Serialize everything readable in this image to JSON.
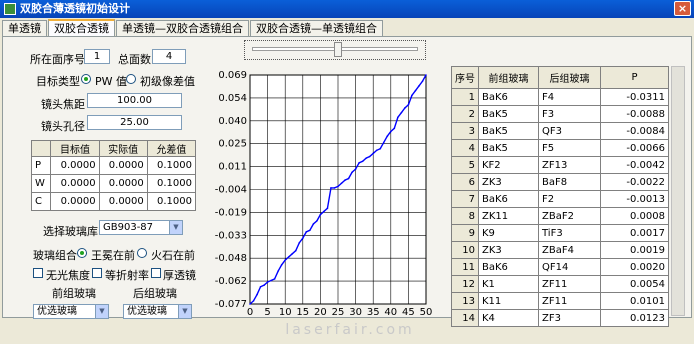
{
  "window": {
    "title": "双胶合薄透镜初始设计",
    "close": "×"
  },
  "tabs": [
    "单透镜",
    "双胶合透镜",
    "单透镜—双胶合透镜组合",
    "双胶合透镜—单透镜组合"
  ],
  "form": {
    "surface_index_label": "所在面序号",
    "surface_index": "1",
    "total_surfaces_label": "总面数",
    "total_surfaces": "4",
    "target_type_label": "目标类型",
    "target_opt1": "PW 值",
    "target_opt2": "初级像差值",
    "focal_label": "镜头焦距",
    "focal_value": "100.00",
    "aperture_label": "镜头孔径",
    "aperture_value": "25.00",
    "glass_lib_label": "选择玻璃库",
    "glass_lib_value": "GB903-87",
    "combo_label": "玻璃组合",
    "combo_opt1": "王冕在前",
    "combo_opt2": "火石在前",
    "check1": "无光焦度",
    "check2": "等折射率",
    "check3": "厚透镜",
    "front_glass_label": "前组玻璃",
    "rear_glass_label": "后组玻璃",
    "front_glass_value": "优选玻璃",
    "rear_glass_value": "优选玻璃"
  },
  "aberration_table": {
    "headers": [
      "",
      "目标值",
      "实际值",
      "允差值"
    ],
    "rows": [
      [
        "P",
        "0.0000",
        "0.0000",
        "0.1000"
      ],
      [
        "W",
        "0.0000",
        "0.0000",
        "0.1000"
      ],
      [
        "C",
        "0.0000",
        "0.0000",
        "0.1000"
      ]
    ]
  },
  "glass_table": {
    "headers": [
      "序号",
      "前组玻璃",
      "后组玻璃",
      "P"
    ],
    "rows": [
      [
        "1",
        "BaK6",
        "F4",
        "-0.0311"
      ],
      [
        "2",
        "BaK5",
        "F3",
        "-0.0088"
      ],
      [
        "3",
        "BaK5",
        "QF3",
        "-0.0084"
      ],
      [
        "4",
        "BaK5",
        "F5",
        "-0.0066"
      ],
      [
        "5",
        "KF2",
        "ZF13",
        "-0.0042"
      ],
      [
        "6",
        "ZK3",
        "BaF8",
        "-0.0022"
      ],
      [
        "7",
        "BaK6",
        "F2",
        "-0.0013"
      ],
      [
        "8",
        "ZK11",
        "ZBaF2",
        "0.0008"
      ],
      [
        "9",
        "K9",
        "TiF3",
        "0.0017"
      ],
      [
        "10",
        "ZK3",
        "ZBaF4",
        "0.0019"
      ],
      [
        "11",
        "BaK6",
        "QF14",
        "0.0020"
      ],
      [
        "12",
        "K1",
        "ZF11",
        "0.0054"
      ],
      [
        "13",
        "K11",
        "ZF11",
        "0.0101"
      ],
      [
        "14",
        "K4",
        "ZF3",
        "0.0123"
      ]
    ]
  },
  "slider": {
    "value_fraction": 0.52
  },
  "chart_data": {
    "type": "line",
    "xlim": [
      0,
      50
    ],
    "ylim": [
      -0.077,
      0.069
    ],
    "xticks": [
      "0",
      "5",
      "10",
      "15",
      "20",
      "25",
      "30",
      "35",
      "40",
      "45",
      "50"
    ],
    "yticks": [
      "0.069",
      "0.054",
      "0.040",
      "0.025",
      "0.011",
      "-0.004",
      "-0.019",
      "-0.033",
      "-0.048",
      "-0.062",
      "-0.077"
    ],
    "grid": true,
    "line_color": "#0000ff",
    "x": [
      0,
      1,
      2,
      3,
      4,
      5,
      6,
      7,
      8,
      9,
      10,
      11,
      12,
      13,
      14,
      15,
      16,
      17,
      18,
      19,
      20,
      21,
      22,
      23,
      24,
      25,
      26,
      27,
      28,
      29,
      30,
      31,
      32,
      33,
      34,
      35,
      36,
      37,
      38,
      39,
      40,
      41,
      42,
      43,
      44,
      45,
      46,
      47,
      48,
      49,
      50
    ],
    "y": [
      -0.077,
      -0.075,
      -0.071,
      -0.066,
      -0.065,
      -0.063,
      -0.062,
      -0.061,
      -0.056,
      -0.052,
      -0.049,
      -0.047,
      -0.045,
      -0.043,
      -0.038,
      -0.035,
      -0.031,
      -0.03,
      -0.026,
      -0.024,
      -0.02,
      -0.018,
      -0.016,
      -0.003,
      -0.003,
      -0.002,
      0.0,
      0.002,
      0.003,
      0.007,
      0.009,
      0.013,
      0.014,
      0.016,
      0.017,
      0.019,
      0.021,
      0.022,
      0.026,
      0.03,
      0.033,
      0.035,
      0.042,
      0.045,
      0.048,
      0.05,
      0.056,
      0.059,
      0.062,
      0.065,
      0.069
    ]
  },
  "watermark": "laserfair.com"
}
